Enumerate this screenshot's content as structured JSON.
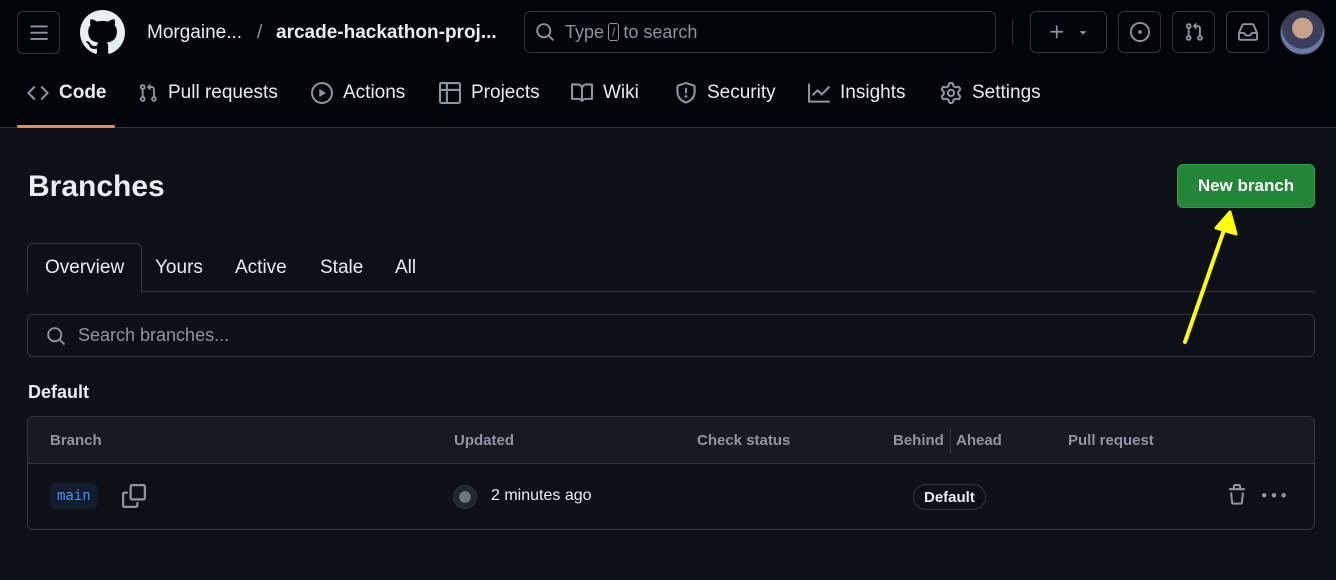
{
  "header": {
    "breadcrumb": {
      "owner": "Morgaine...",
      "separator": "/",
      "repo": "arcade-hackathon-proj..."
    },
    "search": {
      "prefix": "Type",
      "key": "/",
      "suffix": "to search"
    },
    "icons": [
      "menu-icon",
      "github-logo-icon",
      "plus-icon",
      "triangle-down-icon",
      "issue-opened-icon",
      "git-pull-request-icon",
      "inbox-icon"
    ]
  },
  "repo_nav": {
    "items": [
      {
        "label": "Code",
        "icon": "code-icon",
        "active": true
      },
      {
        "label": "Pull requests",
        "icon": "git-pull-request-icon"
      },
      {
        "label": "Actions",
        "icon": "play-icon"
      },
      {
        "label": "Projects",
        "icon": "table-icon"
      },
      {
        "label": "Wiki",
        "icon": "book-icon"
      },
      {
        "label": "Security",
        "icon": "shield-icon"
      },
      {
        "label": "Insights",
        "icon": "graph-icon"
      },
      {
        "label": "Settings",
        "icon": "gear-icon"
      }
    ]
  },
  "page": {
    "title": "Branches",
    "new_branch_label": "New branch",
    "tabs": [
      "Overview",
      "Yours",
      "Active",
      "Stale",
      "All"
    ],
    "active_tab": "Overview",
    "search_placeholder": "Search branches...",
    "section_label": "Default"
  },
  "table": {
    "headers": {
      "branch": "Branch",
      "updated": "Updated",
      "check_status": "Check status",
      "behind": "Behind",
      "ahead": "Ahead",
      "pull_request": "Pull request"
    },
    "rows": [
      {
        "branch": "main",
        "updated": "2 minutes ago",
        "badge": "Default"
      }
    ]
  },
  "colors": {
    "accent_green": "#238636",
    "nav_underline": "#f78166",
    "branch_blue": "#4493f8",
    "annotation_arrow": "#ffff00"
  }
}
